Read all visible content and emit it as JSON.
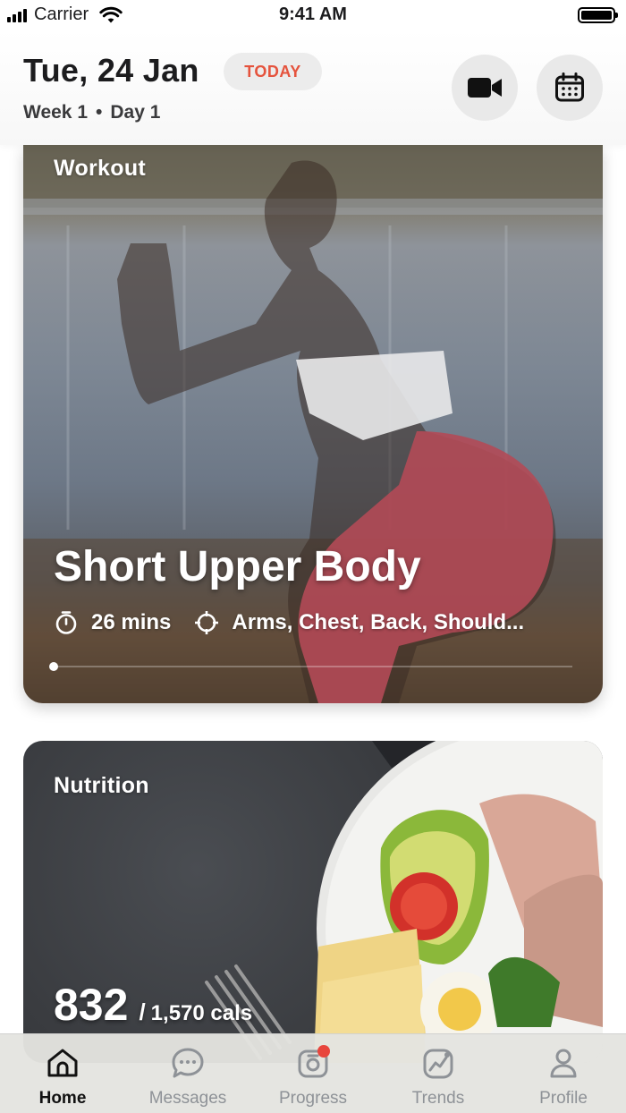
{
  "status_bar": {
    "carrier": "Carrier",
    "time": "9:41 AM"
  },
  "header": {
    "date": "Tue, 24 Jan",
    "today_badge": "TODAY",
    "week": "Week 1",
    "separator": "•",
    "day": "Day 1",
    "video_icon": "video-camera-icon",
    "calendar_icon": "calendar-icon"
  },
  "workout": {
    "label": "Workout",
    "title": "Short Upper Body",
    "duration": "26 mins",
    "targets": "Arms, Chest, Back, Should...",
    "progress": 0.0
  },
  "nutrition": {
    "label": "Nutrition",
    "consumed": "832",
    "separator": "/",
    "goal": "1,570 cals"
  },
  "tabs": [
    {
      "label": "Home",
      "icon": "home-icon",
      "active": true
    },
    {
      "label": "Messages",
      "icon": "chat-icon",
      "active": false
    },
    {
      "label": "Progress",
      "icon": "camera-progress-icon",
      "active": false,
      "badge": true
    },
    {
      "label": "Trends",
      "icon": "trend-chart-icon",
      "active": false
    },
    {
      "label": "Profile",
      "icon": "user-icon",
      "active": false
    }
  ],
  "colors": {
    "accent": "#e5533d",
    "badge": "#e8453c",
    "tab_active": "#111111",
    "tab_inactive": "#8e9297"
  }
}
